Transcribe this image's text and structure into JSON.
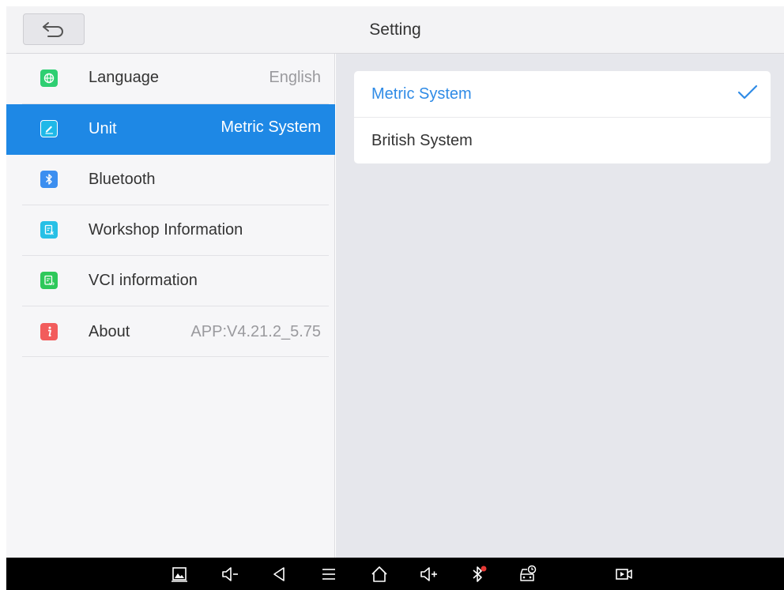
{
  "header": {
    "title": "Setting",
    "back_icon": "back-arrow-icon"
  },
  "menu": {
    "items": [
      {
        "label": "Language",
        "value": "English",
        "icon": "globe-icon",
        "icon_color": "#2ecf72",
        "selected": false
      },
      {
        "label": "Unit",
        "value": "Metric System",
        "icon": "pencil-icon",
        "icon_color": "#1fb8e8",
        "selected": true
      },
      {
        "label": "Bluetooth",
        "value": "",
        "icon": "bluetooth-icon",
        "icon_color": "#3b8ef0",
        "selected": false
      },
      {
        "label": "Workshop Information",
        "value": "",
        "icon": "workshop-doc-icon",
        "icon_color": "#27c0e6",
        "selected": false
      },
      {
        "label": "VCI information",
        "value": "",
        "icon": "vci-doc-icon",
        "icon_color": "#2ec85a",
        "selected": false
      },
      {
        "label": "About",
        "value": "APP:V4.21.2_5.75",
        "icon": "info-icon",
        "icon_color": "#f25c5c",
        "selected": false
      }
    ]
  },
  "unit_options": [
    {
      "label": "Metric System",
      "checked": true
    },
    {
      "label": "British System",
      "checked": false
    }
  ],
  "colors": {
    "accent": "#1e88e5",
    "checked_text": "#2f8be6",
    "bluetooth_alert": "#e53935"
  },
  "navbar": {
    "buttons": [
      "screenshot-icon",
      "volume-down-icon",
      "back-triangle-icon",
      "menu-icon",
      "home-icon",
      "volume-up-icon",
      "bluetooth-status-icon",
      "car-diagnostic-icon",
      "screen-record-icon"
    ]
  }
}
